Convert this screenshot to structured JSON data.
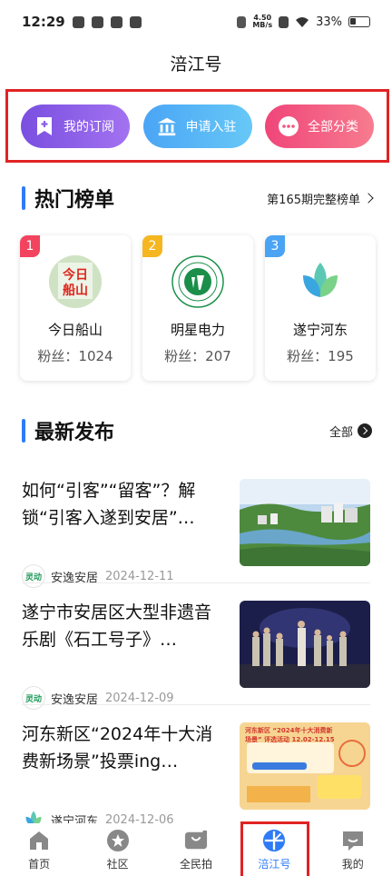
{
  "status_bar": {
    "time": "12:29",
    "net_speed_top": "4.50",
    "net_speed_bottom": "MB/s",
    "battery": "33%"
  },
  "header": {
    "title": "涪江号"
  },
  "top_buttons": [
    {
      "label": "我的订阅",
      "icon": "subscribe-plus-icon"
    },
    {
      "label": "申请入驻",
      "icon": "building-icon"
    },
    {
      "label": "全部分类",
      "icon": "more-dots-icon"
    }
  ],
  "hot_list": {
    "title": "热门榜单",
    "more_label": "第165期完整榜单",
    "items": [
      {
        "rank": "1",
        "name": "今日船山",
        "fans": "粉丝：1024",
        "logo_text": "今日船山",
        "rank_color": "#f2445f"
      },
      {
        "rank": "2",
        "name": "明星电力",
        "fans": "粉丝：207",
        "logo_text": "",
        "rank_color": "#f5b620"
      },
      {
        "rank": "3",
        "name": "遂宁河东",
        "fans": "粉丝：195",
        "logo_text": "",
        "rank_color": "#4ba3f3"
      }
    ]
  },
  "latest": {
    "title": "最新发布",
    "more_label": "全部",
    "items": [
      {
        "title": "如何“引客”“留客”？解锁“引客入遂到安居”…",
        "source": "安逸安居",
        "source_logo": "灵动安居",
        "date": "2024-12-11",
        "image": "river-town-aerial"
      },
      {
        "title": "遂宁市安居区大型非遗音乐剧《石工号子》…",
        "source": "安逸安居",
        "source_logo": "灵动安居",
        "date": "2024-12-09",
        "image": "stage-performance"
      },
      {
        "title": "河东新区“2024年十大消费新场景”投票ing…",
        "source": "遂宁河东",
        "source_logo": "",
        "date": "2024-12-06",
        "image": "consumption-poster",
        "image_text": "河东新区 “2024年十大消费新场景” 评选活动 12.02-12.15"
      }
    ]
  },
  "tab_bar": [
    {
      "label": "首页",
      "icon": "home-icon",
      "active": false
    },
    {
      "label": "社区",
      "icon": "community-star-icon",
      "active": false
    },
    {
      "label": "全民拍",
      "icon": "camera-video-icon",
      "active": false
    },
    {
      "label": "涪江号",
      "icon": "fujiang-compass-icon",
      "active": true
    },
    {
      "label": "我的",
      "icon": "profile-icon",
      "active": false
    }
  ],
  "colors": {
    "accent": "#2f7bf6",
    "highlight_box": "#e02323"
  }
}
